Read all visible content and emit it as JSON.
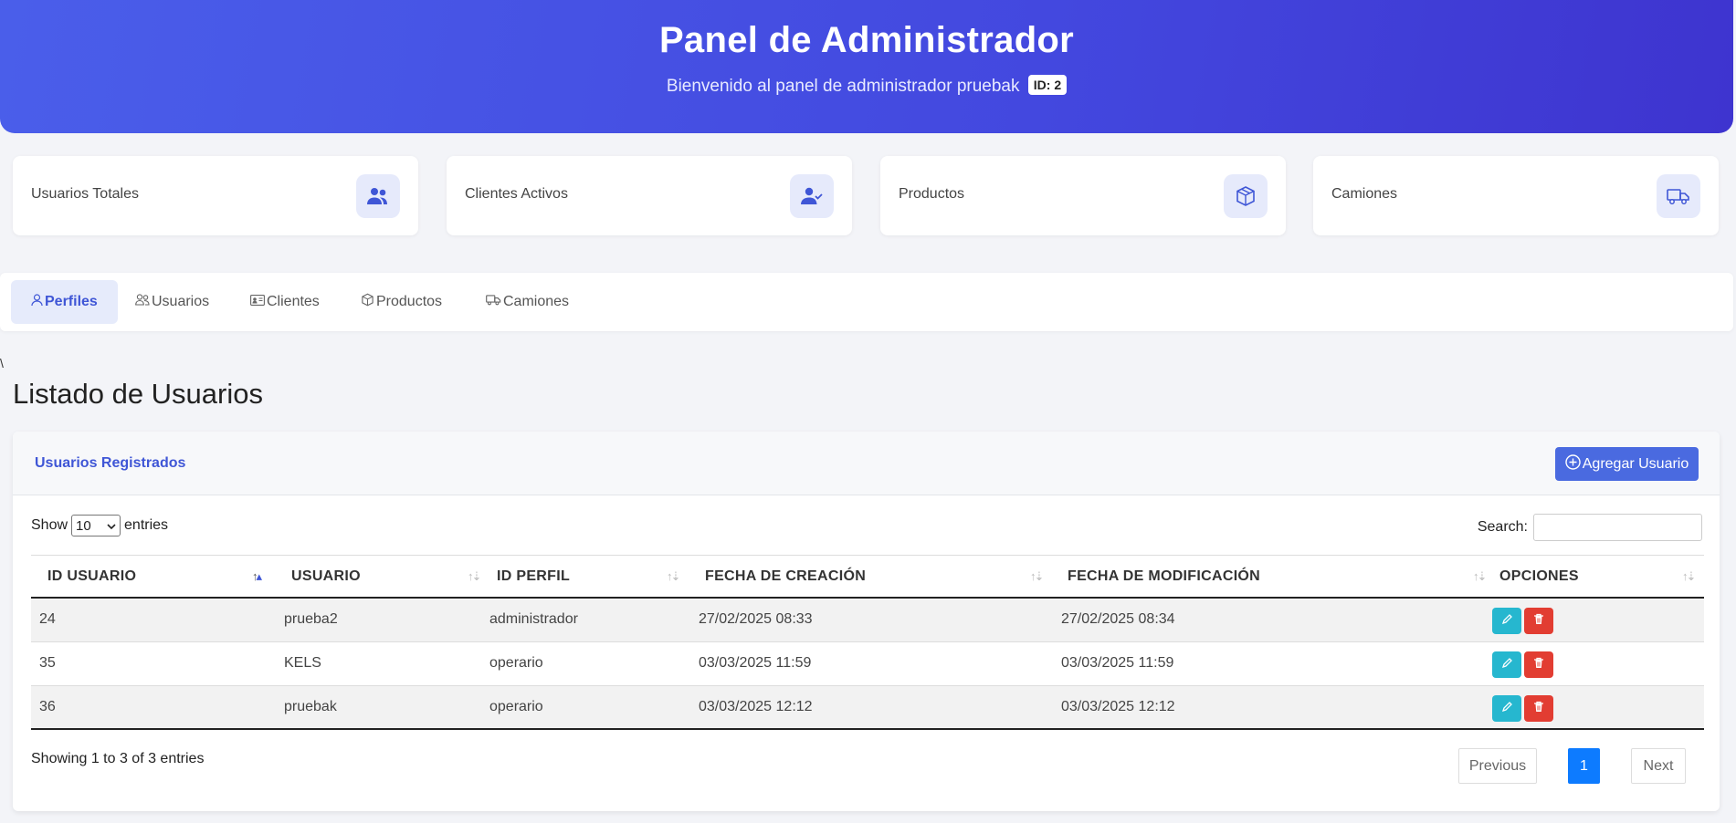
{
  "header": {
    "title": "Panel de Administrador",
    "subtitle": "Bienvenido al panel de administrador pruebak",
    "id_badge": "ID: 2"
  },
  "stats": [
    {
      "label": "Usuarios Totales",
      "icon": "users-icon"
    },
    {
      "label": "Clientes Activos",
      "icon": "user-check-icon"
    },
    {
      "label": "Productos",
      "icon": "box-icon"
    },
    {
      "label": "Camiones",
      "icon": "truck-icon"
    }
  ],
  "tabs": [
    {
      "label": "Perfiles",
      "icon": "person-icon",
      "active": true
    },
    {
      "label": "Usuarios",
      "icon": "people-icon"
    },
    {
      "label": "Clientes",
      "icon": "id-card-icon"
    },
    {
      "label": "Productos",
      "icon": "box-icon"
    },
    {
      "label": "Camiones",
      "icon": "truck-icon"
    }
  ],
  "stray_char": "\\",
  "page_title": "Listado de Usuarios",
  "card": {
    "title": "Usuarios Registrados",
    "add_button": "Agregar Usuario"
  },
  "length_menu": {
    "prefix": "Show",
    "selected": "10",
    "suffix": "entries"
  },
  "search": {
    "label": "Search:",
    "value": ""
  },
  "table": {
    "columns": [
      "ID USUARIO",
      "USUARIO",
      "ID PERFIL",
      "FECHA DE CREACIÓN",
      "FECHA DE MODIFICACIÓN",
      "OPCIONES"
    ],
    "rows": [
      {
        "id": "24",
        "usuario": "prueba2",
        "perfil": "administrador",
        "creacion": "27/02/2025 08:33",
        "modificacion": "27/02/2025 08:34"
      },
      {
        "id": "35",
        "usuario": "KELS",
        "perfil": "operario",
        "creacion": "03/03/2025 11:59",
        "modificacion": "03/03/2025 11:59"
      },
      {
        "id": "36",
        "usuario": "pruebak",
        "perfil": "operario",
        "creacion": "03/03/2025 12:12",
        "modificacion": "03/03/2025 12:12"
      }
    ]
  },
  "info": "Showing 1 to 3 of 3 entries",
  "pagination": {
    "previous": "Previous",
    "current": "1",
    "next": "Next"
  },
  "colors": {
    "accent": "#4a6ae0",
    "edit": "#26b7cf",
    "delete": "#e23d32",
    "page_active": "#0d7bff"
  }
}
